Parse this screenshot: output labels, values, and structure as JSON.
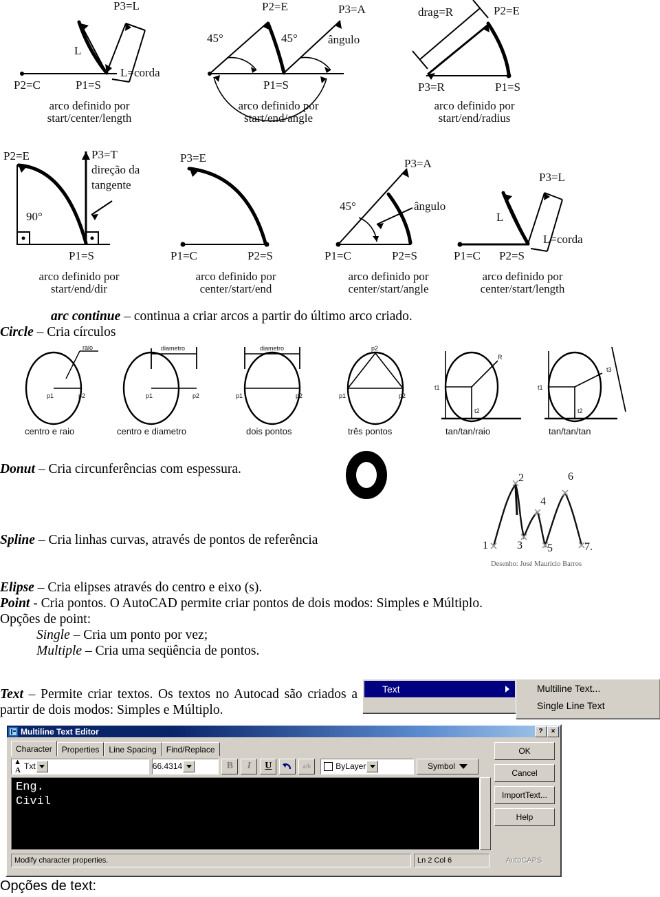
{
  "arc_diagrams": [
    {
      "id": "start-center-length",
      "caption_l1": "arco definido por",
      "caption_l2": "start/center/length",
      "labels": [
        "P3=L",
        "L",
        "L=corda",
        "P2=C",
        "P1=S"
      ]
    },
    {
      "id": "start-end-angle",
      "caption_l1": "arco definido por",
      "caption_l2": "start/end/angle",
      "labels": [
        "P2=E",
        "45°",
        "45°",
        "P3=A",
        "ângulo",
        "P1=S"
      ]
    },
    {
      "id": "start-end-radius",
      "caption_l1": "arco definido por",
      "caption_l2": "start/end/radius",
      "labels": [
        "drag=R",
        "P2=E",
        "P3=R",
        "P1=S"
      ]
    },
    {
      "id": "start-end-dir",
      "caption_l1": "arco definido por",
      "caption_l2": "start/end/dir",
      "labels": [
        "P2=E",
        "P3=T",
        "direção da",
        "tangente",
        "90°",
        "P1=S"
      ]
    },
    {
      "id": "center-start-end",
      "caption_l1": "arco definido por",
      "caption_l2": "center/start/end",
      "labels": [
        "P3=E",
        "P1=C",
        "P2=S"
      ]
    },
    {
      "id": "center-start-angle",
      "caption_l1": "arco definido por",
      "caption_l2": "center/start/angle",
      "labels": [
        "P3=A",
        "45°",
        "ângulo",
        "P1=C",
        "P2=S"
      ]
    },
    {
      "id": "center-start-length",
      "caption_l1": "arco definido por",
      "caption_l2": "center/start/length",
      "labels": [
        "P3=L",
        "L",
        "L=corda",
        "P1=C",
        "P2=S"
      ]
    }
  ],
  "text_blocks": {
    "arc_continue": {
      "term": "arc continue",
      "rest": " – continua a criar arcos a partir do último arco criado."
    },
    "circle": {
      "term": "Circle",
      "rest": " – Cria círculos"
    },
    "donut": {
      "term": "Donut",
      "rest": " – Cria circunferências com espessura."
    },
    "spline": {
      "term": "Spline",
      "rest": " – Cria linhas curvas, através de pontos de referência"
    },
    "elipse": {
      "term": "Elipse",
      "rest": " – Cria elipses através do centro e eixo (s)."
    },
    "point": {
      "term": "Point",
      "rest": " - Cria pontos. O AutoCAD permite criar pontos de dois modos: Simples e Múltiplo."
    },
    "point_options_label": "Opções de point:",
    "single": {
      "term": "Single",
      "rest": " – Cria um ponto por vez;"
    },
    "multiple": {
      "term": "Multiple",
      "rest": " – Cria uma seqüência de pontos."
    },
    "text": {
      "term": "Text",
      "rest": " – Permite criar textos. Os textos no Autocad são criados a partir de dois modos: Simples e Múltiplo."
    },
    "text_options_label": "Opções de text:"
  },
  "circle_diagrams": [
    {
      "caption": "centro e raio",
      "labels": [
        "raio",
        "p1",
        "p2"
      ]
    },
    {
      "caption": "centro e diametro",
      "labels": [
        "diametro",
        "p1",
        "p2"
      ]
    },
    {
      "caption": "dois pontos",
      "labels": [
        "diametro",
        "p1",
        "p2"
      ]
    },
    {
      "caption": "três pontos",
      "labels": [
        "p2",
        "p1",
        "p2"
      ]
    },
    {
      "caption": "tan/tan/raio",
      "labels": [
        "R",
        "t1",
        "t2"
      ]
    },
    {
      "caption": "tan/tan/tan",
      "labels": [
        "t1",
        "t2",
        "t3"
      ]
    }
  ],
  "spline_figure": {
    "point_labels": [
      "1",
      "2",
      "3",
      "4",
      "5",
      "6",
      "7."
    ],
    "credit": "Desenho: José Maurício Barros"
  },
  "menu": {
    "parent_label": "Text",
    "submenu_items": [
      "Multiline Text...",
      "Single Line Text"
    ]
  },
  "dialog": {
    "title": "Multiline Text Editor",
    "title_buttons": [
      "?",
      "×"
    ],
    "tabs": [
      "Character",
      "Properties",
      "Line Spacing",
      "Find/Replace"
    ],
    "font_value": "Txt",
    "size_value": "66.4314",
    "format_buttons": [
      "B",
      "I",
      "U"
    ],
    "undo_label": "undo-arrow",
    "stack_label": "a/b",
    "color_value": "ByLayer",
    "symbol_label": "Symbol",
    "action_buttons": [
      "OK",
      "Cancel",
      "ImportText...",
      "Help"
    ],
    "editor_lines": [
      "Eng.",
      "Civil"
    ],
    "status_hint": "Modify character properties.",
    "status_position": "Ln 2 Col 6",
    "status_caps": "AutoCAPS"
  },
  "colors": {
    "title_blue": "#0a246a",
    "menu_select": "#000080",
    "face": "#d4d0c8",
    "editor_bg": "#000000"
  }
}
